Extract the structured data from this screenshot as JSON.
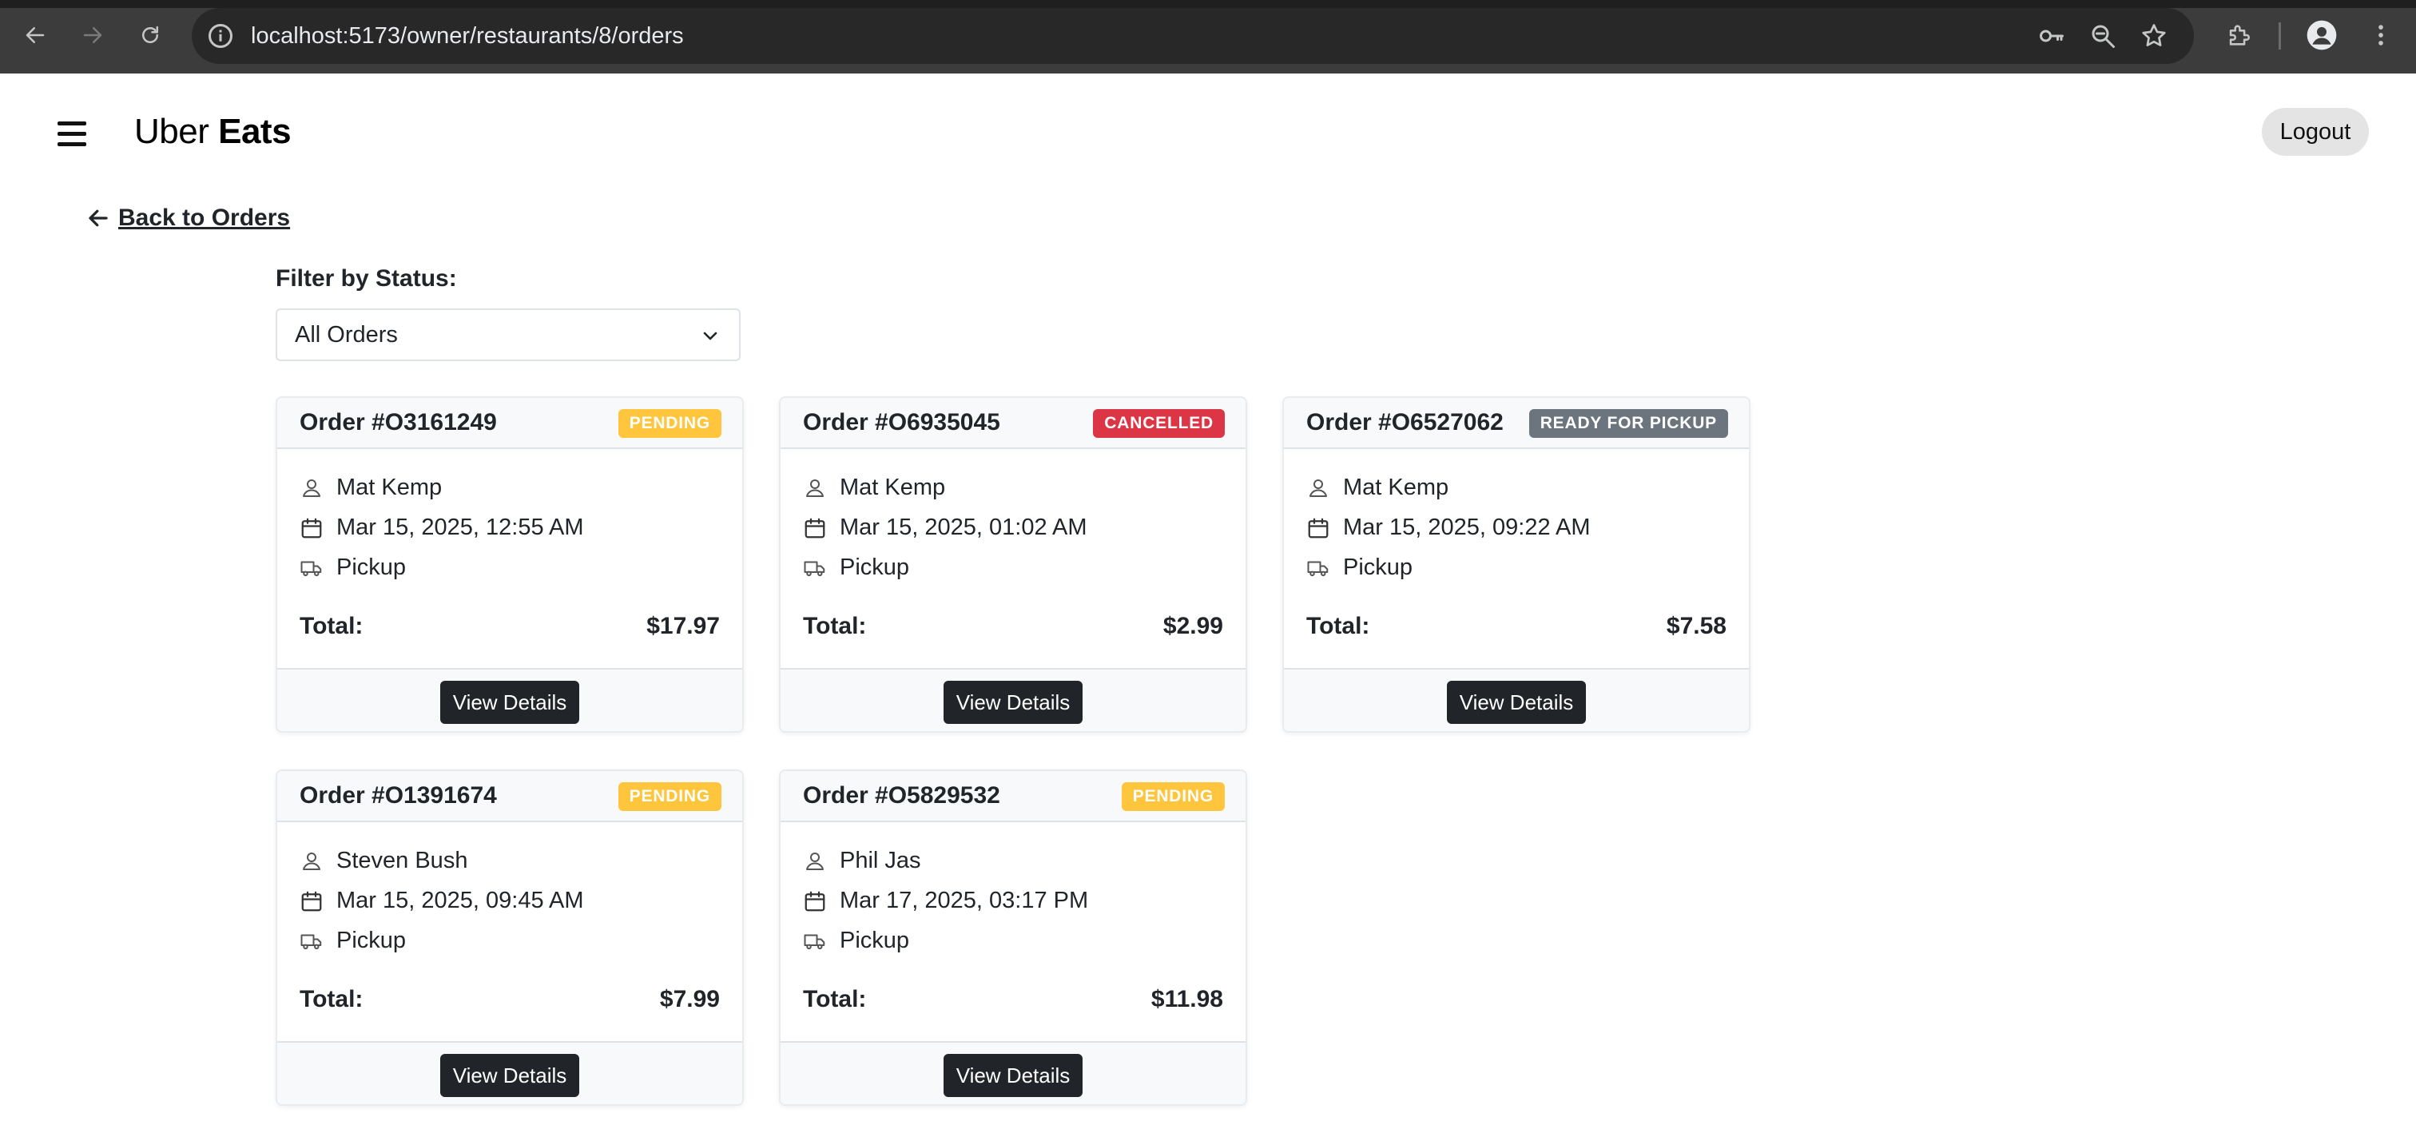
{
  "browser": {
    "url": "localhost:5173/owner/restaurants/8/orders"
  },
  "header": {
    "brand_light": "Uber",
    "brand_bold": "Eats",
    "logout_label": "Logout"
  },
  "back_link": "Back to Orders",
  "filter": {
    "label": "Filter by Status:",
    "selected": "All Orders"
  },
  "total_label": "Total:",
  "view_details_label": "View Details",
  "orders": [
    {
      "title": "Order #O3161249",
      "status": "PENDING",
      "status_color": "#ffc53d",
      "status_text_color": "#ffffff",
      "customer": "Mat Kemp",
      "date": "Mar 15, 2025, 12:55 AM",
      "type": "Pickup",
      "total": "$17.97"
    },
    {
      "title": "Order #O6935045",
      "status": "CANCELLED",
      "status_color": "#dc3545",
      "status_text_color": "#ffffff",
      "customer": "Mat Kemp",
      "date": "Mar 15, 2025, 01:02 AM",
      "type": "Pickup",
      "total": "$2.99"
    },
    {
      "title": "Order #O6527062",
      "status": "READY FOR PICKUP",
      "status_color": "#6c757d",
      "status_text_color": "#ffffff",
      "customer": "Mat Kemp",
      "date": "Mar 15, 2025, 09:22 AM",
      "type": "Pickup",
      "total": "$7.58"
    },
    {
      "title": "Order #O1391674",
      "status": "PENDING",
      "status_color": "#ffc53d",
      "status_text_color": "#ffffff",
      "customer": "Steven Bush",
      "date": "Mar 15, 2025, 09:45 AM",
      "type": "Pickup",
      "total": "$7.99"
    },
    {
      "title": "Order #O5829532",
      "status": "PENDING",
      "status_color": "#ffc53d",
      "status_text_color": "#ffffff",
      "customer": "Phil Jas",
      "date": "Mar 17, 2025, 03:17 PM",
      "type": "Pickup",
      "total": "$11.98"
    }
  ]
}
